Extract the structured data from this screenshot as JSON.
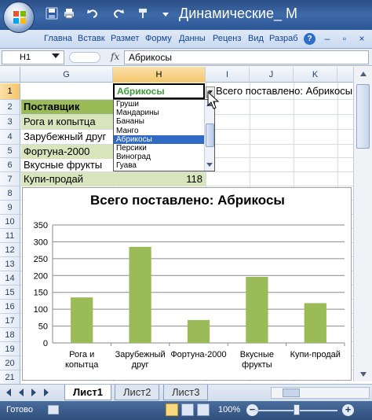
{
  "window": {
    "title": "Динамические_ М",
    "controls": [
      "minimize",
      "maximize",
      "close"
    ]
  },
  "quick_access": [
    "save-icon",
    "undo-icon",
    "redo-icon",
    "customize-icon"
  ],
  "ribbon_tabs": [
    "Главна",
    "Вставк",
    "Размет",
    "Форму",
    "Данны",
    "Реценз",
    "Вид",
    "Разраб"
  ],
  "formula_bar": {
    "name_box": "H1",
    "fx": "fx",
    "formula": "Абрикосы"
  },
  "columns": [
    "G",
    "H",
    "I",
    "J",
    "K"
  ],
  "rows": [
    "1",
    "2",
    "3",
    "4",
    "5",
    "6",
    "7",
    "8",
    "9",
    "10",
    "11",
    "12",
    "13",
    "14",
    "15",
    "16",
    "17",
    "18",
    "19",
    "20",
    "21"
  ],
  "active_cell": "Абрикосы",
  "cells": {
    "i1": "Всего поставлено: Абрикосы",
    "g2": "Поставщик",
    "g3": "Рога и копытца",
    "g4": "Зарубежный друг",
    "g5": "Фортуна-2000",
    "g6": "Вкусные фрукты",
    "g7": "Купи-продай",
    "h7": "118"
  },
  "dropdown": {
    "items": [
      "Груши",
      "Мандарины",
      "Бананы",
      "Манго",
      "Абрикосы",
      "Персики",
      "Виноград",
      "Гуава"
    ],
    "selected": "Абрикосы"
  },
  "chart_data": {
    "type": "bar",
    "title": "Всего поставлено: Абрикосы",
    "categories": [
      "Рога и копытца",
      "Зарубежный друг",
      "Фортуна-2000",
      "Вкусные фрукты",
      "Купи-продай"
    ],
    "category_lines": [
      [
        "Рога и",
        "копытца"
      ],
      [
        "Зарубежный",
        "друг"
      ],
      [
        "Фортуна-2000"
      ],
      [
        "Вкусные",
        "фрукты"
      ],
      [
        "Купи-продай"
      ]
    ],
    "values": [
      135,
      285,
      68,
      196,
      118
    ],
    "yticks": [
      "0",
      "50",
      "100",
      "150",
      "200",
      "250",
      "300",
      "350"
    ],
    "ylim": [
      0,
      350
    ],
    "grid": true,
    "legend": "none",
    "bar_color": "#9bbb59"
  },
  "sheet_tabs": [
    "Лист1",
    "Лист2",
    "Лист3"
  ],
  "active_sheet": "Лист1",
  "status": {
    "text": "Готово",
    "zoom": "100%"
  }
}
